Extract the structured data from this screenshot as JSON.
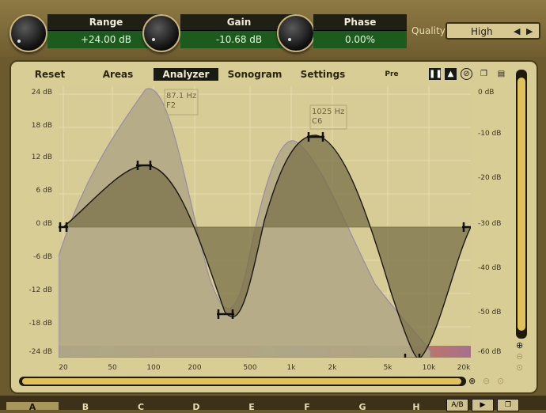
{
  "controls": [
    {
      "name": "Range",
      "value": "+24.00 dB"
    },
    {
      "name": "Gain",
      "value": "-10.68 dB"
    },
    {
      "name": "Phase",
      "value": "0.00%"
    }
  ],
  "quality": {
    "label": "Quality",
    "value": "High"
  },
  "tabs": [
    "Reset",
    "Areas",
    "Analyzer",
    "Sonogram",
    "Settings"
  ],
  "active_tab": "Analyzer",
  "pre_label": "Pre",
  "toolbar_icons": [
    "pause-icon",
    "freeze-icon",
    "disable-icon",
    "copy-icon",
    "paste-icon"
  ],
  "plot": {
    "y_left_ticks": [
      "24 dB",
      "18 dB",
      "12 dB",
      "6 dB",
      "0 dB",
      "-6 dB",
      "-12 dB",
      "-18 dB",
      "-24 dB"
    ],
    "y_right_ticks": [
      "0 dB",
      "-10 dB",
      "-20 dB",
      "-30 dB",
      "-40 dB",
      "-50 dB",
      "-60 dB"
    ],
    "x_ticks": [
      "20",
      "50",
      "100",
      "200",
      "500",
      "1k",
      "2k",
      "5k",
      "10k",
      "20k"
    ],
    "annotations": [
      {
        "line1": "87.1 Hz",
        "line2": "F2"
      },
      {
        "line1": "1025 Hz",
        "line2": "C6"
      }
    ]
  },
  "bottom_tabs": [
    "A",
    "B",
    "C",
    "D",
    "E",
    "F",
    "G",
    "H"
  ],
  "bottom_active": "A",
  "bottom_buttons": [
    "A/B",
    "undo-icon",
    "copy-icon"
  ],
  "colors": {
    "panel": "#d9cd96",
    "frame": "#6b5a2e",
    "value_bg": "#1d5a1d",
    "accent": "#e1c25a"
  }
}
